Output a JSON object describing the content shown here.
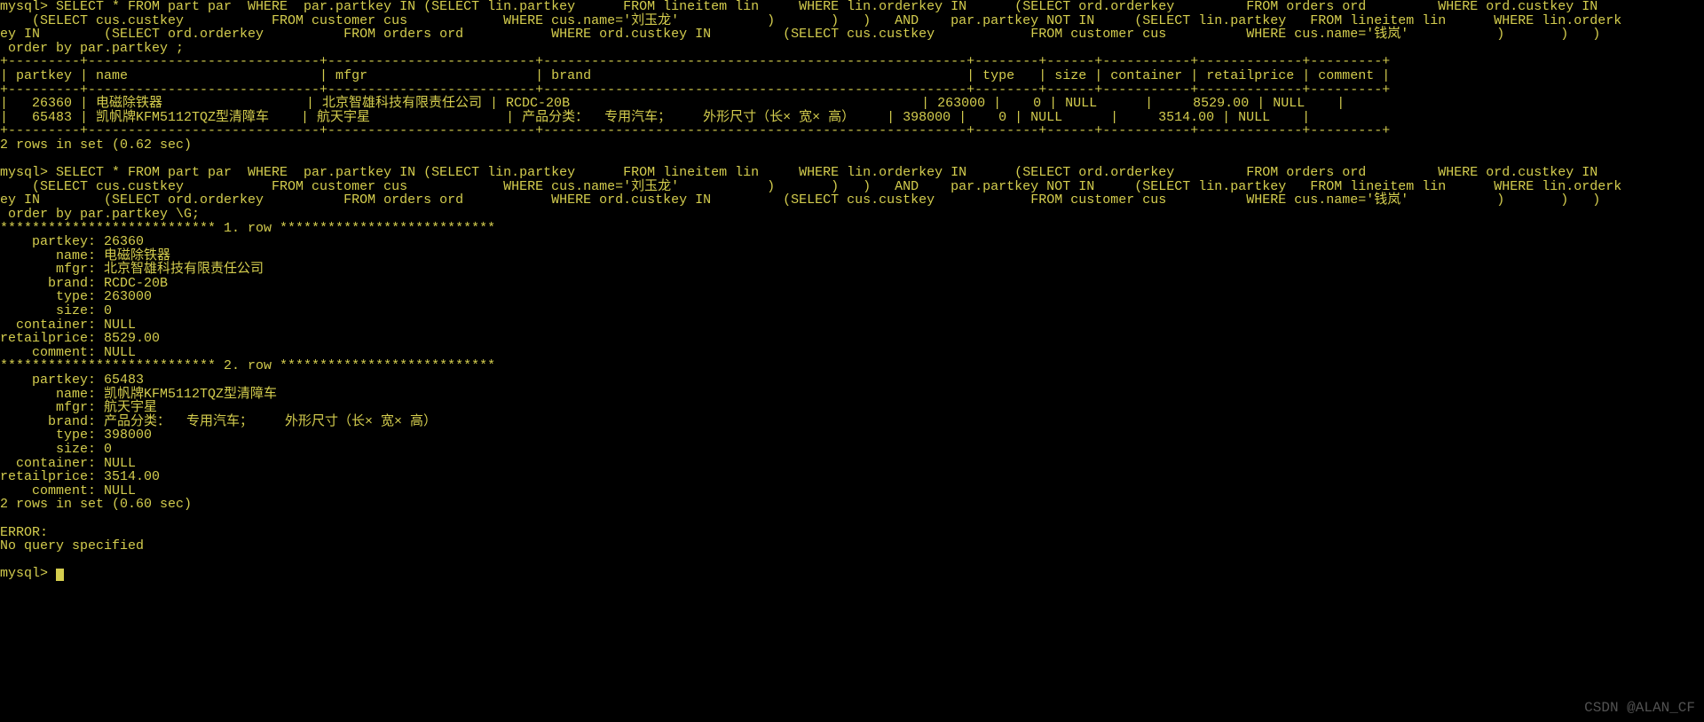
{
  "prompt": "mysql> ",
  "query1": "SELECT * FROM part par  WHERE  par.partkey IN (SELECT lin.partkey      FROM lineitem lin     WHERE lin.orderkey IN      (SELECT ord.orderkey         FROM orders ord         WHERE ord.custkey IN        (SELECT cus.custkey           FROM customer cus            WHERE cus.name='刘玉龙'           )       )   )   AND    par.partkey NOT IN     (SELECT lin.partkey   FROM lineitem lin      WHERE lin.orderkey IN        (SELECT ord.orderkey          FROM orders ord           WHERE ord.custkey IN         (SELECT cus.custkey            FROM customer cus          WHERE cus.name='钱岚'           )       )   )    order by par.partkey ;",
  "table_sep": "+---------+-----------------------------+--------------------------+-----------------------------------------------------+--------+------+-----------+-------------+---------+",
  "columns": [
    "partkey",
    "name",
    "mfgr",
    "brand",
    "type",
    "size",
    "container",
    "retailprice",
    "comment"
  ],
  "rows": [
    {
      "partkey": "26360",
      "name": "电磁除铁器",
      "mfgr": "北京智雄科技有限责任公司",
      "brand": "RCDC-20B",
      "type": "263000",
      "size": "0",
      "container": "NULL",
      "retailprice": "8529.00",
      "comment": "NULL"
    },
    {
      "partkey": "65483",
      "name": "凯帆牌KFM5112TQZ型清障车",
      "mfgr": "航天宇星",
      "brand": "产品分类：  专用汽车；    外形尺寸（长× 宽× 高）",
      "type": "398000",
      "size": "0",
      "container": "NULL",
      "retailprice": "3514.00",
      "comment": "NULL"
    }
  ],
  "rows_msg1": "2 rows in set (0.62 sec)",
  "query2": "SELECT * FROM part par  WHERE  par.partkey IN (SELECT lin.partkey      FROM lineitem lin     WHERE lin.orderkey IN      (SELECT ord.orderkey         FROM orders ord         WHERE ord.custkey IN        (SELECT cus.custkey           FROM customer cus            WHERE cus.name='刘玉龙'           )       )   )   AND    par.partkey NOT IN     (SELECT lin.partkey   FROM lineitem lin      WHERE lin.orderkey IN        (SELECT ord.orderkey          FROM orders ord           WHERE ord.custkey IN         (SELECT cus.custkey            FROM customer cus          WHERE cus.name='钱岚'           )       )   )    order by par.partkey \\G;",
  "row_headers": [
    "1. row",
    "2. row"
  ],
  "fields": [
    "partkey",
    "name",
    "mfgr",
    "brand",
    "type",
    "size",
    "container",
    "retailprice",
    "comment"
  ],
  "rows_msg2": "2 rows in set (0.60 sec)",
  "error1": "ERROR:",
  "error2": "No query specified",
  "watermark": "CSDN @ALAN_CF"
}
